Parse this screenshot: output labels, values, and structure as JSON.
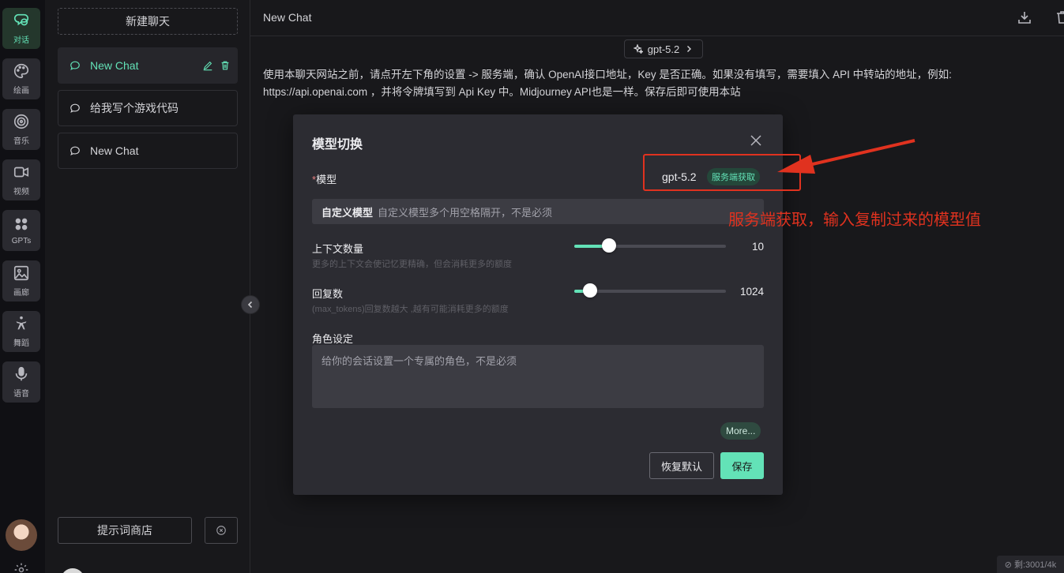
{
  "rail": {
    "items": [
      {
        "label": "对话",
        "icon": "chat-icon",
        "active": true
      },
      {
        "label": "绘画",
        "icon": "palette-icon"
      },
      {
        "label": "音乐",
        "icon": "music-target-icon"
      },
      {
        "label": "视频",
        "icon": "video-icon"
      },
      {
        "label": "GPTs",
        "icon": "grid-icon"
      },
      {
        "label": "画廊",
        "icon": "image-icon"
      },
      {
        "label": "舞蹈",
        "icon": "dance-icon"
      },
      {
        "label": "语音",
        "icon": "mic-icon"
      }
    ]
  },
  "sidebar": {
    "new_chat_label": "新建聊天",
    "chats": [
      {
        "title": "New Chat",
        "active": true
      },
      {
        "title": "给我写个游戏代码"
      },
      {
        "title": "New Chat"
      }
    ],
    "store_label": "提示词商店"
  },
  "header": {
    "title": "New Chat",
    "model_label": "gpt-5.2"
  },
  "notice": {
    "line1": "使用本聊天网站之前，请点开左下角的设置 -> 服务端，确认 OpenAI接口地址，Key 是否正确。如果没有填写，需要填入 API 中转站的地址，例如:",
    "line2": "https://api.openai.com ，并将令牌填写到 Api Key 中。Midjourney API也是一样。保存后即可使用本站"
  },
  "modal": {
    "title": "模型切换",
    "model_field_label": "模型",
    "model_value": "gpt-5.2",
    "model_tag": "服务端获取",
    "custom_key": "自定义模型",
    "custom_placeholder": "自定义模型多个用空格隔开，不是必须",
    "context": {
      "label": "上下文数量",
      "hint": "更多的上下文会使记忆更精确，但会消耗更多的额度",
      "value": "10",
      "fraction": 0.23
    },
    "replies": {
      "label": "回复数",
      "hint": "(max_tokens)回复数越大 ,越有可能消耗更多的额度",
      "value": "1024",
      "fraction": 0.105
    },
    "role_label": "角色设定",
    "role_placeholder": "给你的会话设置一个专属的角色，不是必须",
    "more_label": "More...",
    "reset_label": "恢复默认",
    "save_label": "保存"
  },
  "annotation": {
    "text": "服务端获取，输入复制过来的模型值",
    "color": "#e0321f"
  },
  "footer": {
    "badge": "剩:3001/4k"
  },
  "colors": {
    "accent": "#63e2b7",
    "background": "#18181b",
    "modal": "#2c2c32"
  }
}
